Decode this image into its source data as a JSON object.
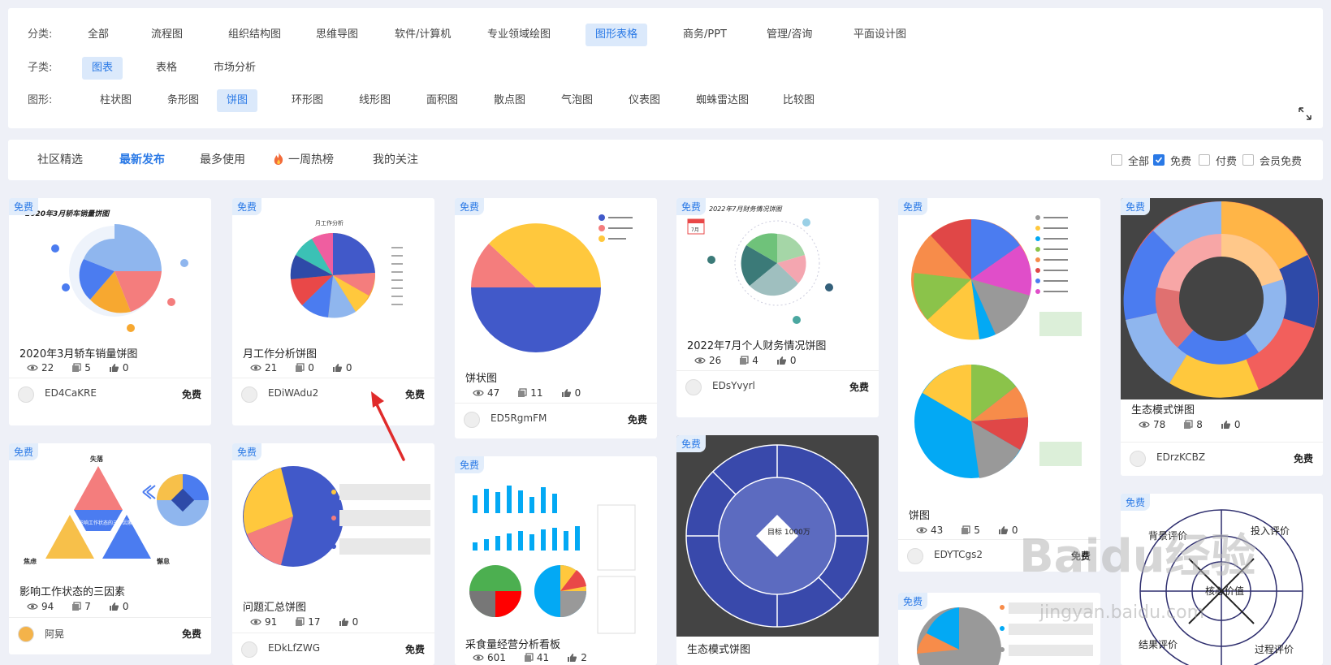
{
  "filters": {
    "category": {
      "label": "分类:",
      "items": [
        "全部",
        "流程图",
        "组织结构图",
        "思维导图",
        "软件/计算机",
        "专业领域绘图",
        "图形表格",
        "商务/PPT",
        "管理/咨询",
        "平面设计图"
      ]
    },
    "subcategory": {
      "label": "子类:",
      "items": [
        "图表",
        "表格",
        "市场分析"
      ]
    },
    "shape": {
      "label": "图形:",
      "items": [
        "柱状图",
        "条形图",
        "饼图",
        "环形图",
        "线形图",
        "面积图",
        "散点图",
        "气泡图",
        "仪表图",
        "蜘蛛雷达图",
        "比较图"
      ]
    }
  },
  "tabs": [
    "社区精选",
    "最新发布",
    "最多使用",
    "一周热榜",
    "我的关注"
  ],
  "price_filters": [
    "全部",
    "免费",
    "付费",
    "会员免费"
  ],
  "badge": "免费",
  "cards": [
    {
      "title": "2020年3月轿车销量饼图",
      "views": "22",
      "copies": "5",
      "likes": "0",
      "author": "ED4CaKRE",
      "price": "免费"
    },
    {
      "title": "月工作分析饼图",
      "views": "21",
      "copies": "0",
      "likes": "0",
      "author": "EDiWAdu2",
      "price": "免费"
    },
    {
      "title": "饼状图",
      "views": "47",
      "copies": "11",
      "likes": "0",
      "author": "ED5RgmFM",
      "price": "免费"
    },
    {
      "title": "2022年7月个人财务情况饼图",
      "views": "26",
      "copies": "4",
      "likes": "0",
      "author": "EDsYvyrl",
      "price": "免费"
    },
    {
      "title": "饼图",
      "views": "43",
      "copies": "5",
      "likes": "0",
      "author": "EDYTCgs2",
      "price": "免费"
    },
    {
      "title": "生态模式饼图",
      "views": "78",
      "copies": "8",
      "likes": "0",
      "author": "EDrzKCBZ",
      "price": "免费"
    },
    {
      "title": "影响工作状态的三因素",
      "views": "94",
      "copies": "7",
      "likes": "0",
      "author": "阿晃",
      "price": "免费"
    },
    {
      "title": "问题汇总饼图",
      "views": "91",
      "copies": "17",
      "likes": "0",
      "author": "EDkLfZWG",
      "price": "免费"
    },
    {
      "title": "采食量经营分析看板",
      "views": "601",
      "copies": "41",
      "likes": "2",
      "author": "",
      "price": ""
    },
    {
      "title": "生态模式饼图",
      "views": "",
      "copies": "",
      "likes": "",
      "author": "",
      "price": ""
    }
  ],
  "thumb_text": {
    "card0_title": "2020年3月轿车销量饼图",
    "card1_title": "月工作分析",
    "card3_title": "2022年7月财务情况饼图",
    "card3_date": "7月",
    "card8_center": "目标\n1000万",
    "card7_center": "",
    "card6_top": "失落",
    "card6_left": "焦虑",
    "card6_right": "懈怠",
    "card6_center": "影响工作状态的三个因素",
    "card_last_center": "核心价值",
    "card_last_labels": [
      "投入评价",
      "过程评价",
      "结果评价",
      "背景评价"
    ]
  },
  "watermark": "Baidu经验",
  "watermark_url": "jingyan.baidu.com",
  "colors": {
    "accent": "#2a79e6",
    "badge_bg": "#e2edfb"
  }
}
